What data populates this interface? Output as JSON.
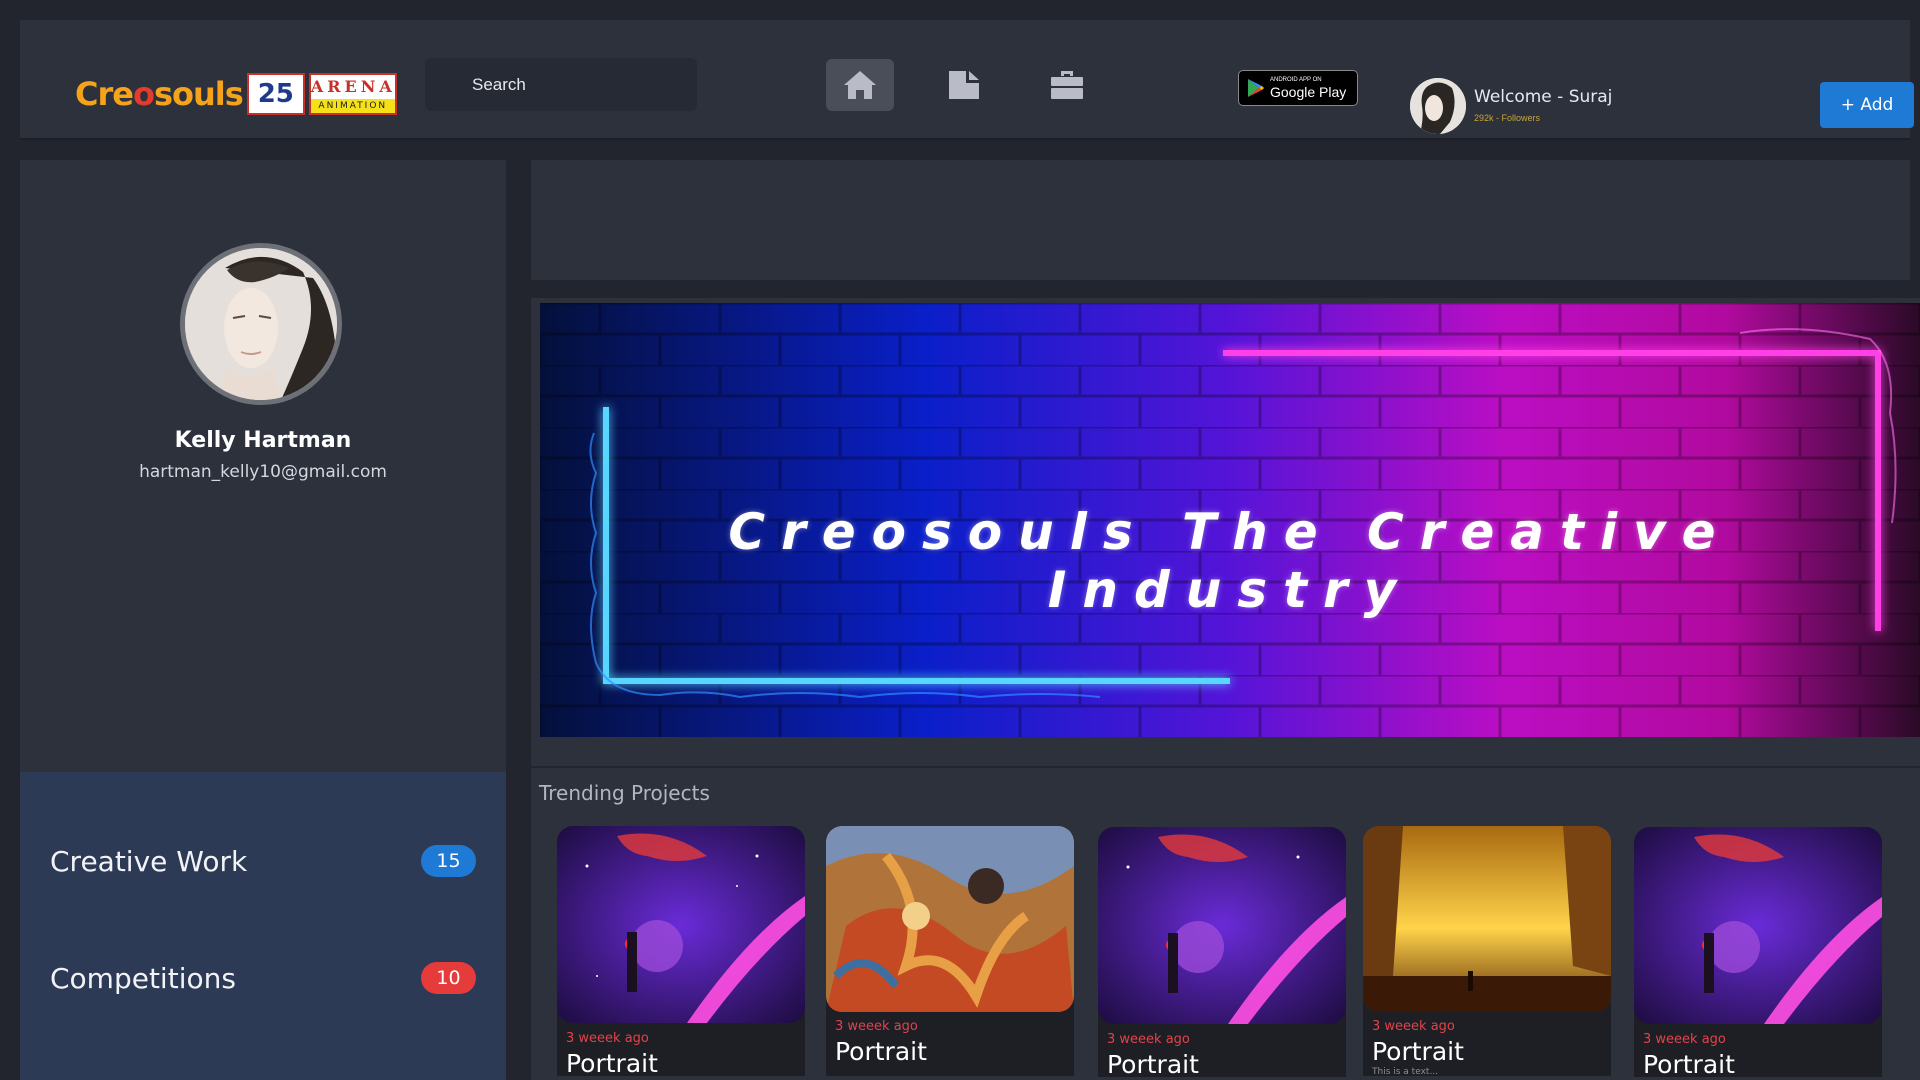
{
  "header": {
    "logo_text_a": "Cre",
    "logo_text_o": "o",
    "logo_text_b": "souls",
    "badge_25": "25",
    "arena_top": "ARENA",
    "arena_bottom": "ANIMATION",
    "search_placeholder": "Search",
    "nav_icons": [
      "home-icon",
      "document-icon",
      "briefcase-icon"
    ],
    "google_play_small": "ANDROID APP ON",
    "google_play_big": "Google Play",
    "welcome": "Welcome - Suraj",
    "followers": "292k - Followers",
    "add_button": "+ Add"
  },
  "profile": {
    "name": "Kelly Hartman",
    "email": "hartman_kelly10@gmail.com"
  },
  "stats": [
    {
      "label": "Creative Work",
      "count": "15",
      "color": "#1f7ad6"
    },
    {
      "label": "Competitions",
      "count": "10",
      "color": "#e53b3b"
    }
  ],
  "banner": {
    "title": "Creosouls The Creative Industry"
  },
  "trending": {
    "title": "Trending Projects",
    "cards": [
      {
        "ago": "3 weeek ago",
        "title": "Portrait",
        "desc": "",
        "art": "space"
      },
      {
        "ago": "3 weeek ago",
        "title": "Portrait",
        "desc": "",
        "art": "dragon"
      },
      {
        "ago": "3 weeek ago",
        "title": "Portrait",
        "desc": "",
        "art": "space"
      },
      {
        "ago": "3 weeek ago",
        "title": "Portrait",
        "desc": "This is a text...",
        "art": "sunset"
      },
      {
        "ago": "3 weeek ago",
        "title": "Portrait",
        "desc": "",
        "art": "space"
      }
    ]
  },
  "colors": {
    "accent": "#1f7ad6",
    "danger": "#e53b3b",
    "panel": "#2d313c",
    "background": "#22252e"
  }
}
